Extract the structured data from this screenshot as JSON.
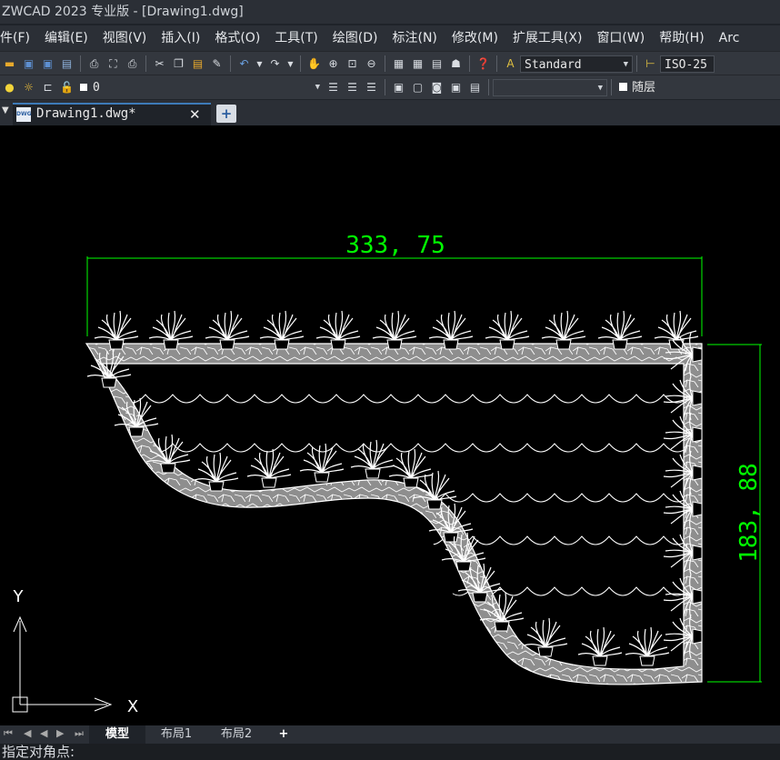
{
  "window": {
    "title": "ZWCAD 2023 专业版 - [Drawing1.dwg]"
  },
  "menu": [
    "件(F)",
    "编辑(E)",
    "视图(V)",
    "插入(I)",
    "格式(O)",
    "工具(T)",
    "绘图(D)",
    "标注(N)",
    "修改(M)",
    "扩展工具(X)",
    "窗口(W)",
    "帮助(H)",
    "Arc"
  ],
  "toolbar": {
    "text_style": "Standard",
    "dim_style": "ISO-25",
    "layer_name": "0",
    "linetype": "随层"
  },
  "tabs": {
    "doc_tab": "Drawing1.dwg*",
    "close_glyph": "✕",
    "new_glyph": "+"
  },
  "drawing": {
    "dim_horizontal": "333, 75",
    "dim_vertical": "183, 88",
    "ucs_x": "X",
    "ucs_y": "Y",
    "dim_color": "#00ff00"
  },
  "layout_tabs": {
    "model": "模型",
    "layout1": "布局1",
    "layout2": "布局2",
    "add": "+"
  },
  "command": {
    "prompt": "指定对角点:"
  }
}
